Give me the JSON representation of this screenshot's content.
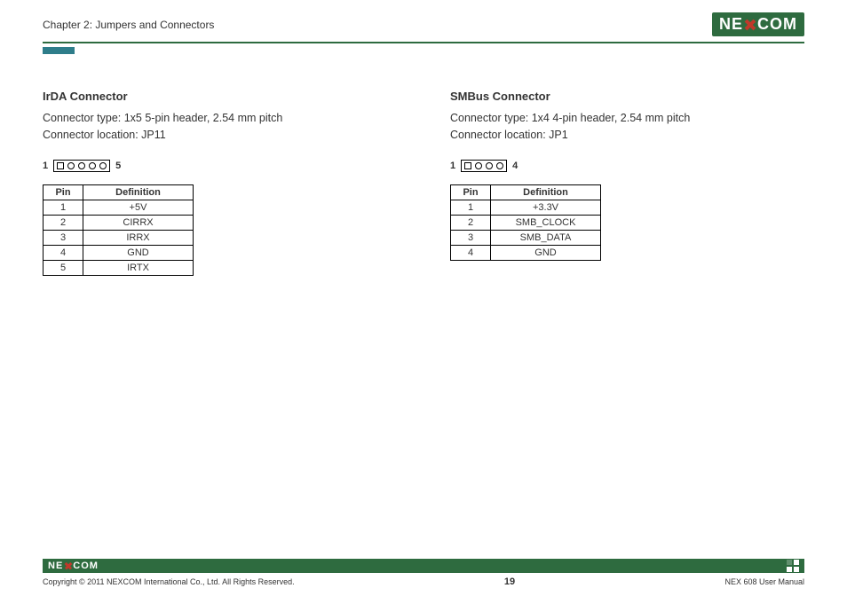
{
  "header": {
    "chapter": "Chapter 2: Jumpers and Connectors",
    "logo_left": "NE",
    "logo_right": "COM"
  },
  "left": {
    "title": "IrDA Connector",
    "type_line": "Connector type: 1x5 5-pin header, 2.54 mm pitch",
    "loc_line": "Connector location: JP11",
    "pin_start": "1",
    "pin_end": "5",
    "pin_count": 5,
    "th_pin": "Pin",
    "th_def": "Definition",
    "rows": [
      {
        "pin": "1",
        "def": "+5V"
      },
      {
        "pin": "2",
        "def": "CIRRX"
      },
      {
        "pin": "3",
        "def": "IRRX"
      },
      {
        "pin": "4",
        "def": "GND"
      },
      {
        "pin": "5",
        "def": "IRTX"
      }
    ]
  },
  "right": {
    "title": "SMBus Connector",
    "type_line": "Connector type: 1x4 4-pin header, 2.54 mm pitch",
    "loc_line": "Connector location: JP1",
    "pin_start": "1",
    "pin_end": "4",
    "pin_count": 4,
    "th_pin": "Pin",
    "th_def": "Definition",
    "rows": [
      {
        "pin": "1",
        "def": "+3.3V"
      },
      {
        "pin": "2",
        "def": "SMB_CLOCK"
      },
      {
        "pin": "3",
        "def": "SMB_DATA"
      },
      {
        "pin": "4",
        "def": "GND"
      }
    ]
  },
  "footer": {
    "copyright": "Copyright © 2011 NEXCOM International Co., Ltd. All Rights Reserved.",
    "page": "19",
    "manual": "NEX 608 User Manual",
    "logo_left": "NE",
    "logo_right": "COM"
  }
}
